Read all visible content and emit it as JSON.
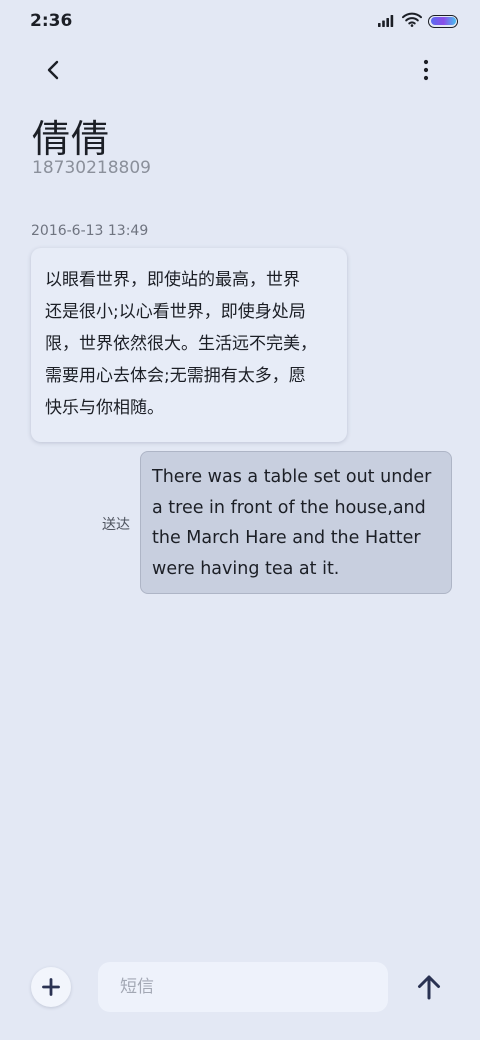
{
  "status_bar": {
    "time": "2:36",
    "icons": [
      "signal-icon",
      "wifi-icon",
      "battery-icon"
    ]
  },
  "header": {
    "back_icon": "chevron-left-icon",
    "more_icon": "more-vertical-icon",
    "contact_name": "倩倩",
    "contact_number": "18730218809"
  },
  "conversation": {
    "timestamp": "2016-6-13 13:49",
    "incoming_message": "以眼看世界，即使站的最高，世界\n还是很小;以心看世界，即使身处局\n限，世界依然很大。生活远不完美，\n需要用心去体会;无需拥有太多，愿\n快乐与你相随。",
    "outgoing_message": "There was a table set out under\na tree in front of the house,and\nthe March Hare and the Hatter\nwere having tea at it.",
    "outgoing_status": "送达"
  },
  "composer": {
    "add_icon": "plus-icon",
    "placeholder": "短信",
    "value": "",
    "send_icon": "arrow-up-icon"
  },
  "colors": {
    "background": "#e3e8f4",
    "incoming_bubble": "#e7ecf7",
    "outgoing_bubble": "#c8cfdf",
    "accent_icon": "#2a3252"
  }
}
